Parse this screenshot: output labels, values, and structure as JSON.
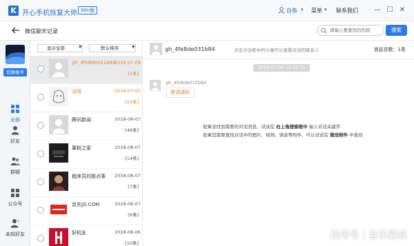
{
  "app": {
    "title": "开心手机恢复大师",
    "edition_badge": "Win版",
    "user_name": "白鱼",
    "menu_label": "菜单",
    "contact_label": "联系我们",
    "logo_letter": "K"
  },
  "window_controls": {
    "minimize": "—",
    "maximize": "☐",
    "close": "✕"
  },
  "subheader": {
    "page_title": "微信聊天记录",
    "search_placeholder": "请输入要查找的内容",
    "search_button": "搜索"
  },
  "sidebar": {
    "switch_account": "切换账号",
    "items": [
      {
        "label": "全部",
        "icon": "grid-icon",
        "active": true
      },
      {
        "label": "好友",
        "icon": "person-icon",
        "active": false
      },
      {
        "label": "群聊",
        "icon": "group-icon",
        "active": false
      },
      {
        "label": "公众号",
        "icon": "apps-icon",
        "active": false
      },
      {
        "label": "未知好友",
        "icon": "unknown-person-icon",
        "active": false
      }
    ]
  },
  "list": {
    "filter_value": "显示全部",
    "sort_value": "默认排序",
    "conversations": [
      {
        "name": "gh_4fe8de031b84",
        "date": "2018-07-09",
        "count": "[1条]",
        "highlight": true,
        "selected": true,
        "avatar": "default"
      },
      {
        "name": "涪哥",
        "date": "2018-07-05",
        "count": "[22条]",
        "highlight": true,
        "selected": false,
        "avatar": "sketch"
      },
      {
        "name": "腾讯新闻",
        "date": "2018-08-07",
        "count": "[46条]",
        "highlight": false,
        "selected": false,
        "avatar": "default"
      },
      {
        "name": "果粉之家",
        "date": "2018-08-07",
        "count": "[14条]",
        "highlight": false,
        "selected": false,
        "avatar": "dark-logo"
      },
      {
        "name": "程序员的那点事",
        "date": "2018-08-07",
        "count": "[7条]",
        "highlight": false,
        "selected": false,
        "avatar": "photo"
      },
      {
        "name": "京东JD.COM",
        "date": "2018-08-07",
        "count": "[6条]",
        "highlight": false,
        "selected": false,
        "avatar": "jd-logo"
      },
      {
        "name": "好机友",
        "date": "2018-08-06",
        "count": "[10条]",
        "highlight": false,
        "selected": false,
        "avatar": "red-logo"
      }
    ]
  },
  "chat": {
    "header_name": "gh_4fe8de031b84",
    "header_hint": "点击对话框中的头像可以查看对话的联系人",
    "total_messages": "消息总数：1条",
    "timestamp": "2018-07-09 12:26:15",
    "sender": "gh_4fe8de031b84",
    "message": "邀请通知",
    "tip_line1_a": "如果没找到需要的对话消息，试试在",
    "tip_line1_b": "右上角搜索框中",
    "tip_line1_c": "输入对话关键字",
    "tip_line2_a": "如果您需要查找对话中的图片、视频、语音等附件，可以试试在",
    "tip_line2_b": "微信附件",
    "tip_line2_c": "中查找"
  },
  "watermark": "快传号 / 音乐囊叔",
  "colors": {
    "accent": "#2c7be5",
    "highlight": "#e8842a"
  }
}
